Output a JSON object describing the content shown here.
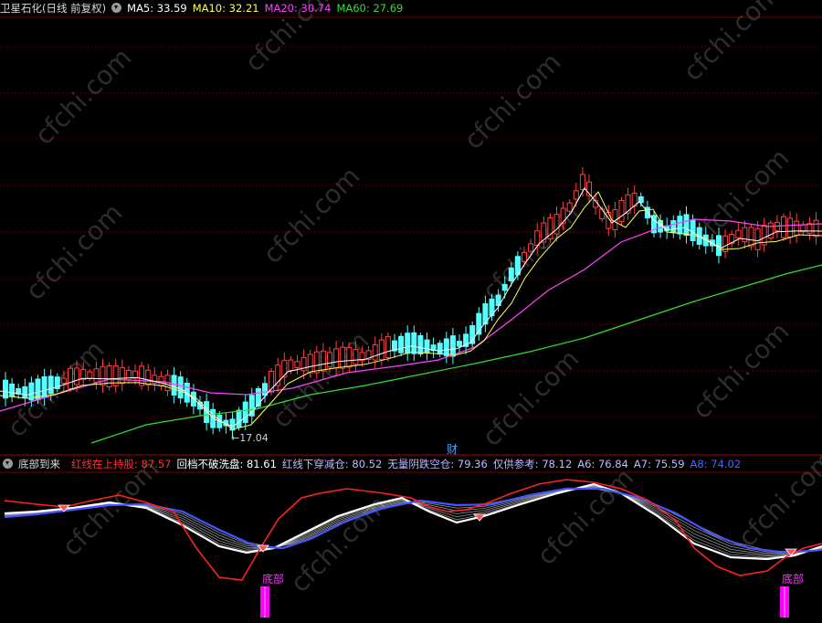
{
  "main_panel": {
    "title": "卫星石化(日线 前复权)",
    "ma_legend": [
      {
        "label": "MA5: 33.59",
        "color": "#ffffff"
      },
      {
        "label": "MA10: 32.21",
        "color": "#ffff55"
      },
      {
        "label": "MA20: 30.74",
        "color": "#ff44ff"
      },
      {
        "label": "MA60: 27.69",
        "color": "#33dd33"
      }
    ],
    "low_marker": "←17.04",
    "finance_marker": "财",
    "watermark": "cfchi.com"
  },
  "indicator_panel": {
    "name": "底部到来",
    "values": [
      {
        "label": "红线在上持股: 87.57",
        "color": "#ff3333"
      },
      {
        "label": "回档不破洗盘: 81.61",
        "color": "#ffffff"
      },
      {
        "label": "红线下穿减仓: 80.52",
        "color": "#bbbbff"
      },
      {
        "label": "无量阴跌空仓: 79.36",
        "color": "#bbbbff"
      },
      {
        "label": "仅供参考: 78.12",
        "color": "#bbbbff"
      },
      {
        "label": "A6: 76.84",
        "color": "#bbbbff"
      },
      {
        "label": "A7: 75.59",
        "color": "#bbbbff"
      },
      {
        "label": "A8: 74.02",
        "color": "#4466ff"
      }
    ],
    "signal_label": "底部",
    "signal_color": "#ff00ff"
  },
  "chart_data": [
    {
      "type": "candlestick",
      "title": "卫星石化(日线 前复权)",
      "annotations": [
        "←17.04",
        "财"
      ],
      "series": [
        {
          "name": "MA5",
          "last": 33.59,
          "color": "#ffffff"
        },
        {
          "name": "MA10",
          "last": 32.21,
          "color": "#ffff55"
        },
        {
          "name": "MA20",
          "last": 30.74,
          "color": "#ff44ff"
        },
        {
          "name": "MA60",
          "last": 27.69,
          "color": "#33dd33"
        }
      ],
      "grid": true
    },
    {
      "type": "line",
      "title": "底部到来",
      "series": [
        {
          "name": "红线在上持股",
          "last": 87.57
        },
        {
          "name": "回档不破洗盘",
          "last": 81.61
        },
        {
          "name": "红线下穿减仓",
          "last": 80.52
        },
        {
          "name": "无量阴跌空仓",
          "last": 79.36
        },
        {
          "name": "仅供参考",
          "last": 78.12
        },
        {
          "name": "A6",
          "last": 76.84
        },
        {
          "name": "A7",
          "last": 75.59
        },
        {
          "name": "A8",
          "last": 74.02
        }
      ],
      "signals": [
        "底部",
        "底部"
      ]
    }
  ]
}
